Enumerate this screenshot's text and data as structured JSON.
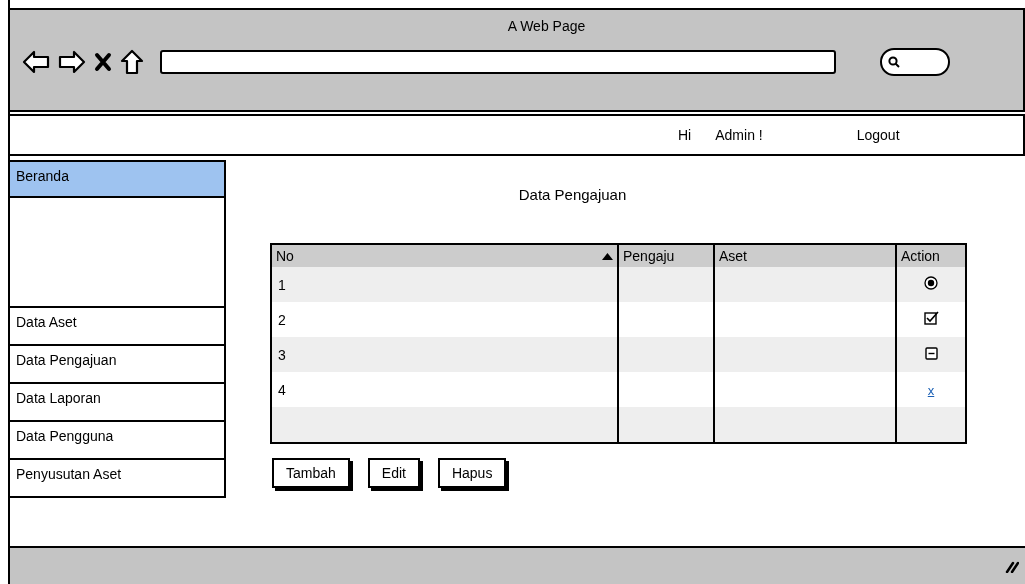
{
  "window": {
    "title": "A Web Page"
  },
  "top_bar": {
    "greeting": "Hi",
    "user": "Admin !",
    "logout": "Logout"
  },
  "sidebar": {
    "items": [
      {
        "label": "Beranda",
        "selected": true
      },
      {
        "label": "Data Aset",
        "selected": false
      },
      {
        "label": "Data Pengajuan",
        "selected": false
      },
      {
        "label": "Data Laporan",
        "selected": false
      },
      {
        "label": "Data Pengguna",
        "selected": false
      },
      {
        "label": "Penyusutan Aset",
        "selected": false
      }
    ]
  },
  "main": {
    "title": "Data Pengajuan"
  },
  "table": {
    "columns": [
      {
        "label": "No",
        "sorted": true
      },
      {
        "label": "Pengaju",
        "sorted": false
      },
      {
        "label": "Aset",
        "sorted": false
      },
      {
        "label": "Action",
        "sorted": false
      }
    ],
    "rows": [
      {
        "no": "1",
        "action": {
          "kind": "radio",
          "selected": true
        }
      },
      {
        "no": "2",
        "action": {
          "kind": "checkbox",
          "checked": true
        }
      },
      {
        "no": "3",
        "action": {
          "kind": "collapse"
        }
      },
      {
        "no": "4",
        "action": {
          "kind": "link",
          "text": "x"
        }
      },
      {
        "no": "",
        "action": {
          "kind": "none"
        }
      }
    ]
  },
  "buttons": [
    "Tambah",
    "Edit",
    "Hapus"
  ]
}
